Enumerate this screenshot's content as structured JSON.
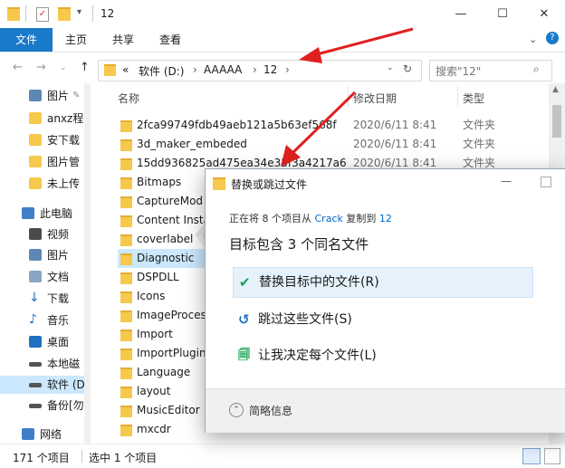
{
  "window": {
    "title": "12",
    "controls": {
      "minimize": "—",
      "maximize": "☐",
      "close": "✕"
    }
  },
  "ribbon": {
    "tabs": [
      "文件",
      "主页",
      "共享",
      "查看"
    ]
  },
  "address": {
    "prefix": "«",
    "crumbs": [
      "软件 (D:)",
      "AAAAA",
      "12"
    ],
    "search_placeholder": "搜索\"12\""
  },
  "sidebar": {
    "items": [
      {
        "label": "图片",
        "icon": "pictures-icon",
        "pin": "✎"
      },
      {
        "label": "anxz程",
        "icon": "folder-icon"
      },
      {
        "label": "安下载",
        "icon": "folder-icon"
      },
      {
        "label": "图片管",
        "icon": "folder-icon"
      },
      {
        "label": "未上传",
        "icon": "folder-icon"
      },
      {
        "label": "此电脑",
        "icon": "computer-icon"
      },
      {
        "label": "视频",
        "icon": "videos-icon"
      },
      {
        "label": "图片",
        "icon": "pictures-icon"
      },
      {
        "label": "文档",
        "icon": "documents-icon"
      },
      {
        "label": "下载",
        "icon": "downloads-icon"
      },
      {
        "label": "音乐",
        "icon": "music-icon"
      },
      {
        "label": "桌面",
        "icon": "desktop-icon"
      },
      {
        "label": "本地磁",
        "icon": "drive-icon"
      },
      {
        "label": "软件 (D",
        "icon": "drive-icon"
      },
      {
        "label": "备份[勿",
        "icon": "drive-icon"
      },
      {
        "label": "网络",
        "icon": "network-icon"
      }
    ]
  },
  "filelist": {
    "headers": {
      "name": "名称",
      "date": "修改日期",
      "type": "类型"
    },
    "rows": [
      {
        "name": "2fca99749fdb49aeb121a5b63ef568f",
        "date": "2020/6/11 8:41",
        "type": "文件夹"
      },
      {
        "name": "3d_maker_embeded",
        "date": "2020/6/11 8:41",
        "type": "文件夹"
      },
      {
        "name": "15dd936825ad475ea34e35f3a4217a6",
        "date": "2020/6/11 8:41",
        "type": "文件夹"
      },
      {
        "name": "Bitmaps",
        "date": "",
        "type": ""
      },
      {
        "name": "CaptureMod",
        "date": "",
        "type": ""
      },
      {
        "name": "Content Insta",
        "date": "",
        "type": ""
      },
      {
        "name": "coverlabel",
        "date": "",
        "type": ""
      },
      {
        "name": "Diagnostic",
        "date": "",
        "type": ""
      },
      {
        "name": "DSPDLL",
        "date": "",
        "type": ""
      },
      {
        "name": "Icons",
        "date": "",
        "type": ""
      },
      {
        "name": "ImageProces",
        "date": "",
        "type": ""
      },
      {
        "name": "Import",
        "date": "",
        "type": ""
      },
      {
        "name": "ImportPlugin",
        "date": "",
        "type": ""
      },
      {
        "name": "Language",
        "date": "",
        "type": ""
      },
      {
        "name": "layout",
        "date": "",
        "type": ""
      },
      {
        "name": "MusicEditor",
        "date": "",
        "type": ""
      },
      {
        "name": "mxcdr",
        "date": "",
        "type": ""
      }
    ]
  },
  "status": {
    "count": "171 个项目",
    "selected": "选中 1 个项目"
  },
  "dialog": {
    "title": "替换或跳过文件",
    "progress_prefix": "正在将 8 个项目从",
    "source": "Crack",
    "progress_mid": "复制到",
    "dest": "12",
    "heading": "目标包含 3 个同名文件",
    "options": [
      {
        "label": "替换目标中的文件(R)",
        "icon": "check-icon",
        "glyph": "✔"
      },
      {
        "label": "跳过这些文件(S)",
        "icon": "skip-icon",
        "glyph": "↺"
      },
      {
        "label": "让我决定每个文件(L)",
        "icon": "decide-icon",
        "glyph": "🗐"
      }
    ],
    "details": "简略信息"
  },
  "colors": {
    "accent": "#1979ca",
    "link": "#0066cc",
    "arrow": "#e02020",
    "check": "#1aa053",
    "folder": "#f6c94c"
  }
}
